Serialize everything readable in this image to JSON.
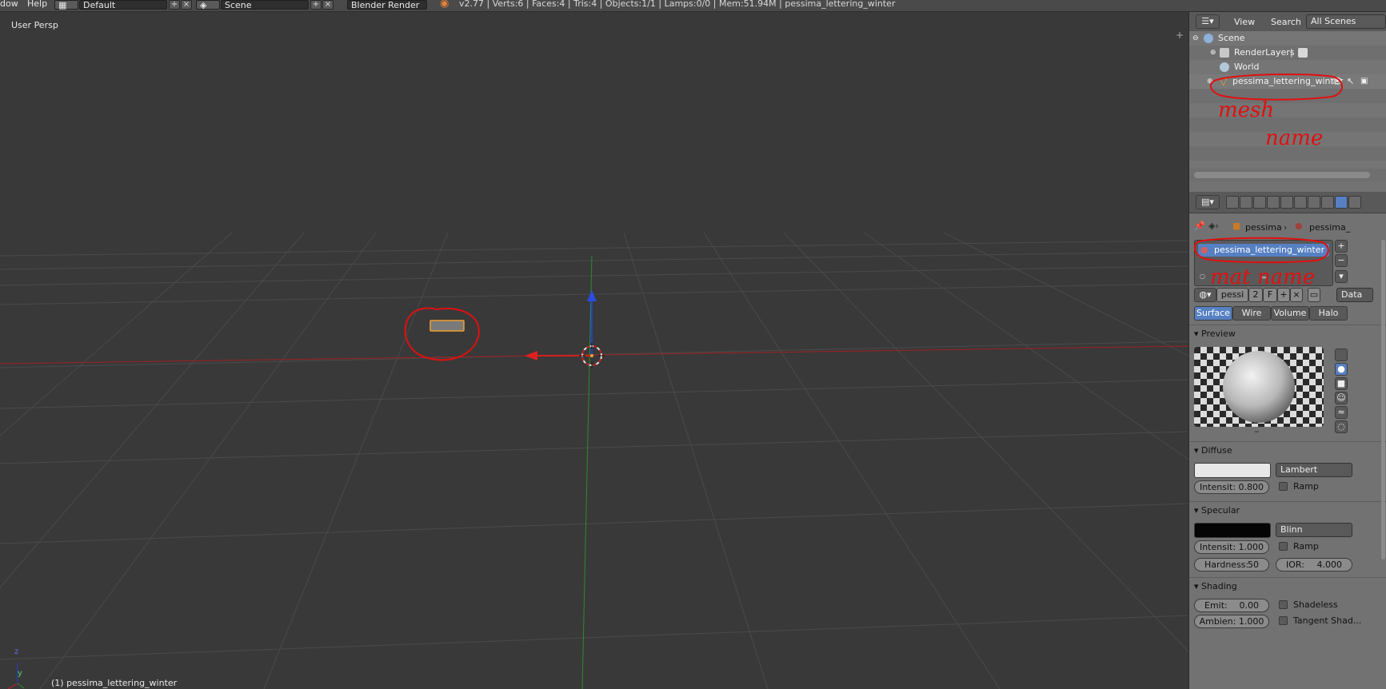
{
  "topbar": {
    "menu_window": "dow",
    "menu_help": "Help",
    "layout_name": "Default",
    "scene_name": "Scene",
    "render_engine": "Blender Render",
    "stats": "v2.77 | Verts:6 | Faces:4 | Tris:4 | Objects:1/1 | Lamps:0/0 | Mem:51.94M | pessima_lettering_winter"
  },
  "viewport": {
    "view_label": "User Persp",
    "object_label": "(1) pessima_lettering_winter",
    "axis_z": "z",
    "axis_y": "y"
  },
  "outliner": {
    "view": "View",
    "search": "Search",
    "filter": "All Scenes",
    "items": [
      {
        "label": "Scene"
      },
      {
        "label": "RenderLayers"
      },
      {
        "label": "World"
      },
      {
        "label": "pessima_lettering_winter"
      }
    ],
    "annotation_1": "mesh",
    "annotation_2": "name"
  },
  "properties": {
    "breadcrumb_object": "pessima",
    "breadcrumb_material": "pessima_",
    "material_slot": "pessima_lettering_winter",
    "annotation": "mat name",
    "mat_name_short": "pessi",
    "user_count": "2",
    "fake_user": "F",
    "link": "Data",
    "tabs": [
      "Surface",
      "Wire",
      "Volume",
      "Halo"
    ],
    "preview_title": "Preview",
    "diffuse_title": "Diffuse",
    "diffuse_shader": "Lambert",
    "diffuse_intensity": "Intensit: 0.800",
    "ramp": "Ramp",
    "specular_title": "Specular",
    "specular_shader": "Blinn",
    "specular_intensity": "Intensit: 1.000",
    "hardness_label": "Hardness:",
    "hardness_value": "50",
    "ior_label": "IOR:",
    "ior_value": "4.000",
    "shading_title": "Shading",
    "emit_label": "Emit:",
    "emit_value": "0.00",
    "ambient": "Ambien: 1.000",
    "shadeless": "Shadeless",
    "tangent": "Tangent Shad..."
  },
  "colors": {
    "accent": "#5680c2",
    "annotation": "#e01010",
    "viewport_bg": "#393939"
  }
}
